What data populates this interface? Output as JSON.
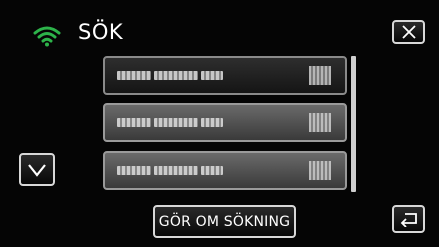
{
  "header": {
    "title": "SÖK",
    "wifi_icon": "wifi-icon",
    "wifi_color": "#2db34a",
    "close_icon": "close-icon"
  },
  "networks": {
    "items": [
      {
        "name": "■■■ ■■■■ ■■",
        "signal_icon": "signal-icon",
        "selected": true
      },
      {
        "name": "■■■ ■■■■ ■■",
        "signal_icon": "signal-icon",
        "selected": false
      },
      {
        "name": "■■■ ■■■■ ■■",
        "signal_icon": "signal-icon",
        "selected": false
      }
    ]
  },
  "controls": {
    "scroll_down_icon": "chevron-down-icon",
    "redo_search_label": "GÖR OM SÖKNING",
    "back_icon": "return-icon"
  }
}
